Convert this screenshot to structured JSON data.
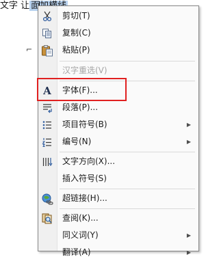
{
  "document": {
    "text_plain": "文字 让",
    "text_selected": "面加横线 "
  },
  "menu": {
    "items": [
      {
        "label": "剪切(T)",
        "icon": "scissors-icon"
      },
      {
        "label": "复制(C)",
        "icon": "copy-icon"
      },
      {
        "label": "粘贴(P)",
        "icon": "paste-icon"
      },
      {
        "label": "汉字重选(V)",
        "icon": "",
        "disabled": true
      },
      {
        "label": "字体(F)...",
        "icon": "font-icon"
      },
      {
        "label": "段落(P)...",
        "icon": "paragraph-icon"
      },
      {
        "label": "项目符号(B)",
        "icon": "bullets-icon",
        "submenu": true
      },
      {
        "label": "编号(N)",
        "icon": "numbering-icon",
        "submenu": true
      },
      {
        "label": "文字方向(X)...",
        "icon": "text-direction-icon"
      },
      {
        "label": "插入符号(S)",
        "icon": ""
      },
      {
        "label": "超链接(H)...",
        "icon": "hyperlink-icon"
      },
      {
        "label": "查阅(K)...",
        "icon": "research-icon"
      },
      {
        "label": "同义词(Y)",
        "icon": "",
        "submenu": true
      },
      {
        "label": "翻译(A)",
        "icon": "",
        "submenu": true
      }
    ],
    "submenu_arrow": "▶"
  },
  "colors": {
    "highlight_border": "#e02020",
    "selection": "#b9d3f0"
  }
}
